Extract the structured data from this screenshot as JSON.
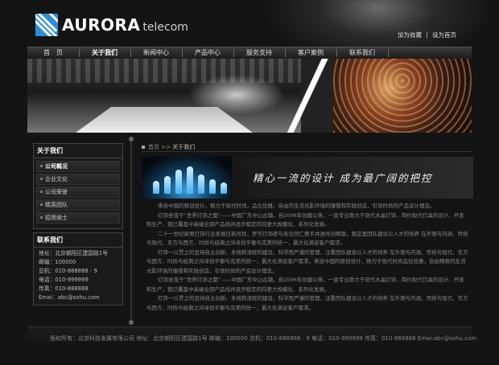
{
  "header": {
    "logo_name": "AURORA",
    "logo_sub": "telecom",
    "top_links": [
      "加为收藏",
      "设为首页"
    ]
  },
  "nav": {
    "items": [
      {
        "label": "首　页"
      },
      {
        "label": "关于我们"
      },
      {
        "label": "新闻中心"
      },
      {
        "label": "产品中心"
      },
      {
        "label": "服务支持"
      },
      {
        "label": "客户案例"
      },
      {
        "label": "联系我们"
      }
    ],
    "active_index": 1
  },
  "sidebar": {
    "about_title": "关于我们",
    "menu": [
      {
        "label": "公司概况"
      },
      {
        "label": "企业文化"
      },
      {
        "label": "公司荣誉"
      },
      {
        "label": "精英团队"
      },
      {
        "label": "招贤纳士"
      }
    ],
    "contact_title": "联系我们",
    "contact_lines": [
      "地址：北京朝阳区建国路1号",
      "邮编：100000",
      "总机：010-888888 - 9",
      "电话：010-999999",
      "传真：010-888888",
      "Emai：abc@sohu.com"
    ]
  },
  "breadcrumb": {
    "home": "首页",
    "separator": ">>",
    "current": "关于我们"
  },
  "feature": {
    "slogan": "精心一流的设计 成为最广阔的把控"
  },
  "content": {
    "paragraphs": [
      "来自中国的原创设计，致力于现代时尚，品位优雅，自由的生活光影环境的憧憬和实践创造，引领时尚的产品设计理念。",
      "灯饰坐落于“世界灯饰之都”——中国广东中山古镇，自2006年创建以来，一直专业致力于现代水晶灯饰、简约现代灯具的设计、开发和生产，我已覆盖中高端全部产品线并逐步稳定的向更大规模化、系列化发展。",
      "二十一世纪家居灯饰行业发展日新月异，罗可灯饰愿与各位同仁携手并进共创辉煌，我这里团队建设以人才的培养 在外观与内涵、传统与现代、东方与西方、时尚与经典之间寻找平衡与完美的统一，最大化满足客户需求。",
      "灯饰一以贯之的坚持自主创新、多线和流程的建设，科学而严谨的管理，注重团队建设以人才的培养 在外观与内涵、传统与现代、东方与西方、时尚与经典之间寻找平衡与完美的统一，最大化满足客户需求。来自中国的原创设计，致力于现代时尚品位优雅，自由精致的生活光影环境的憧憬和实践创造，引领时尚的产品设计理念。",
      "灯饰坐落于“世界灯饰之都”——中国广东中山古镇，自2006年创建以来，一直专业致力于现代水晶灯饰、简约现代灯具的设计、开发和生产，我已覆盖中高端全部产品线并逐步稳定的向更大规模化、系列化发展。",
      "灯饰一以贯之的坚持自主创新、多线和流程的建设，科学而严谨的管理，注重团队建设以人才的培养 在外观与内涵、传统与现代、东方与西方、时尚与经典之间寻找平衡与完美的统一，最大化满足客户需求。"
    ]
  },
  "footer": {
    "text": "版权所有：北京科技发展有限公司 地址：北京朝阳区建国路1号 邮编：100000 总机：010-888888 - 9 电话：010-999999 传真：010-888888 Emai:abc@sohu.com"
  }
}
